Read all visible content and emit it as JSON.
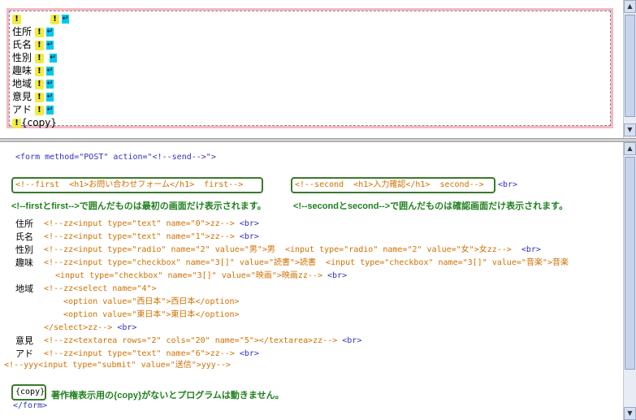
{
  "top_pane": {
    "bang": "!",
    "return_mark": "↵",
    "lines": [
      "",
      "住所",
      "氏名",
      "性別",
      "趣味",
      "地域",
      "意見",
      "アド"
    ],
    "copy_tag": "{copy}"
  },
  "bottom_pane": {
    "form_open": "<form method=\"POST\" action=\"<!--send-->\">",
    "first_box": "<!--first  <h1>お問い合わせフォーム</h1>  first-->",
    "second_box": "<!--second  <h1>入力確認</h1>  second-->",
    "second_br": "<br>",
    "note1": "<!--firstとfirst-->で囲んだものは最初の画面だけ表示されます。",
    "note2": "<!--secondとsecond-->で囲んだものは確認画面だけ表示されます。",
    "rows": [
      {
        "label": "住所",
        "code": "<!--zz<input type=\"text\" name=\"0\">zz--> ",
        "br": "<br>"
      },
      {
        "label": "氏名",
        "code": "<!--zz<input type=\"text\" name=\"1\">zz--> ",
        "br": "<br>"
      },
      {
        "label": "性別",
        "code": "<!--zz<input type=\"radio\" name=\"2\" value=\"男\">男  <input type=\"radio\" name=\"2\" value=\"女\">女zz-->  ",
        "br": "<br>"
      },
      {
        "label": "趣味",
        "code": "<!--zz<input type=\"checkbox\" name=\"3[]\" value=\"読書\">読書  <input type=\"checkbox\" name=\"3[]\" value=\"音楽\">音楽",
        "br": ""
      },
      {
        "label": "",
        "code": "<input type=\"checkbox\" name=\"3[]\" value=\"映画\">映画zz--> ",
        "br": "<br>"
      },
      {
        "label": "地域",
        "code": "<!--zz<select name=\"4\">",
        "br": ""
      },
      {
        "label": "",
        "code": "  <option value=\"西日本\">西日本</option>",
        "br": ""
      },
      {
        "label": "",
        "code": "  <option value=\"東日本\">東日本</option>",
        "br": ""
      },
      {
        "label": "",
        "code": "</select>zz--> ",
        "br": "<br>"
      },
      {
        "label": "意見",
        "code": "<!--zz<textarea rows=\"2\" cols=\"20\" name=\"5\"></textarea>zz--> ",
        "br": "<br>"
      },
      {
        "label": "アド",
        "code": "<!--zz<input type=\"text\" name=\"6\">zz--> ",
        "br": "<br>"
      }
    ],
    "submit_line": "<!--yyy<input type=\"submit\" value=\"送信\">yyy-->",
    "copy_tag": "{copy}",
    "copy_note": "著作権表示用の{copy}がないとプログラムは動きません。",
    "form_close": "</form>"
  },
  "colors": {
    "frame_pink": "#f4b8c4",
    "tag_blue": "#3030c0",
    "comment_orange": "#d07000",
    "note_green": "#208020",
    "box_green": "#3b7a2c"
  }
}
